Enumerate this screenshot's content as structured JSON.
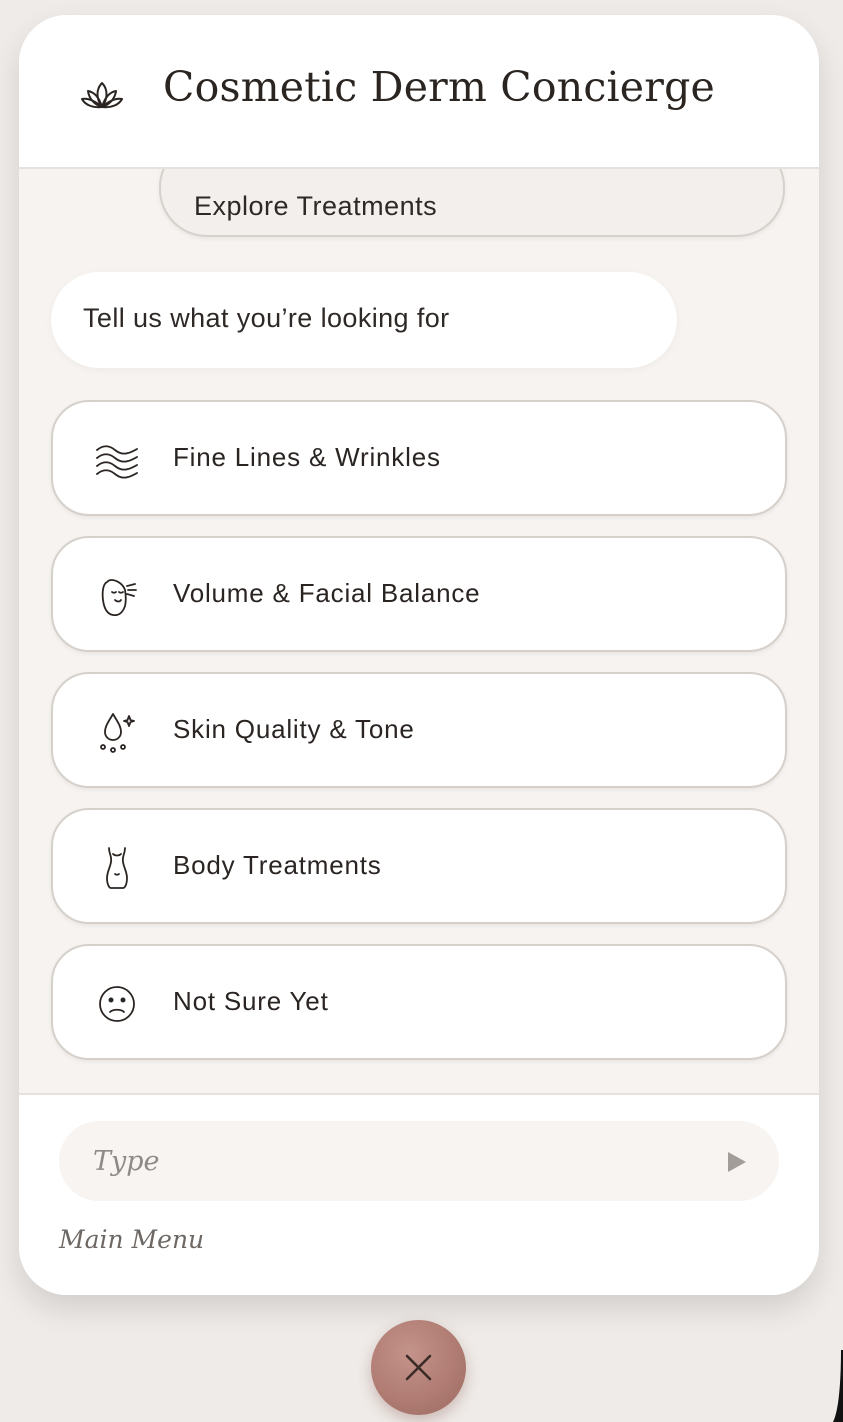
{
  "header": {
    "title": "Cosmetic Derm Concierge",
    "logo_icon": "lotus-icon"
  },
  "conversation": {
    "user_message": "Explore Treatments",
    "bot_prompt": "Tell us what you’re looking for"
  },
  "options": [
    {
      "label": "Fine Lines & Wrinkles",
      "icon": "waves-icon"
    },
    {
      "label": "Volume & Facial Balance",
      "icon": "face-profile-icon"
    },
    {
      "label": "Skin Quality & Tone",
      "icon": "droplet-sparkle-icon"
    },
    {
      "label": "Body Treatments",
      "icon": "body-silhouette-icon"
    },
    {
      "label": "Not Sure Yet",
      "icon": "unsure-face-icon"
    }
  ],
  "composer": {
    "placeholder": "Type",
    "send_icon": "send-arrow-icon",
    "main_menu_label": "Main Menu"
  },
  "close_button": {
    "icon": "close-icon"
  },
  "colors": {
    "accent": "#b07c73",
    "background": "#efebe8",
    "messages_bg": "#f6f3f0",
    "border": "#d6d0cb",
    "text": "#2a2522"
  }
}
